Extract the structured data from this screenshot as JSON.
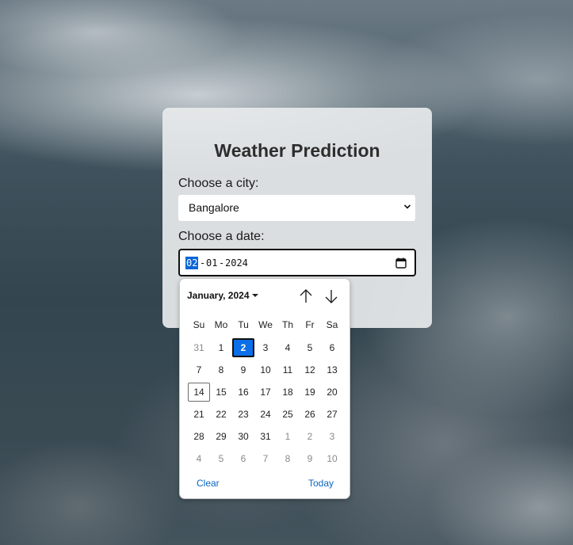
{
  "app": {
    "title": "Weather Prediction"
  },
  "form": {
    "city_label": "Choose a city:",
    "city_value": "Bangalore",
    "date_label": "Choose a date:",
    "date_parts": {
      "month": "02",
      "sep1": "-",
      "day": "01",
      "sep2": "-",
      "year": "2024"
    }
  },
  "calendar": {
    "month_label": "January, 2024",
    "weekdays": [
      "Su",
      "Mo",
      "Tu",
      "We",
      "Th",
      "Fr",
      "Sa"
    ],
    "weeks": [
      [
        {
          "d": "31",
          "other": true
        },
        {
          "d": "1"
        },
        {
          "d": "2",
          "selected": true
        },
        {
          "d": "3"
        },
        {
          "d": "4"
        },
        {
          "d": "5"
        },
        {
          "d": "6"
        }
      ],
      [
        {
          "d": "7"
        },
        {
          "d": "8"
        },
        {
          "d": "9"
        },
        {
          "d": "10"
        },
        {
          "d": "11"
        },
        {
          "d": "12"
        },
        {
          "d": "13"
        }
      ],
      [
        {
          "d": "14",
          "today": true
        },
        {
          "d": "15"
        },
        {
          "d": "16"
        },
        {
          "d": "17"
        },
        {
          "d": "18"
        },
        {
          "d": "19"
        },
        {
          "d": "20"
        }
      ],
      [
        {
          "d": "21"
        },
        {
          "d": "22"
        },
        {
          "d": "23"
        },
        {
          "d": "24"
        },
        {
          "d": "25"
        },
        {
          "d": "26"
        },
        {
          "d": "27"
        }
      ],
      [
        {
          "d": "28"
        },
        {
          "d": "29"
        },
        {
          "d": "30"
        },
        {
          "d": "31"
        },
        {
          "d": "1",
          "other": true
        },
        {
          "d": "2",
          "other": true
        },
        {
          "d": "3",
          "other": true
        }
      ],
      [
        {
          "d": "4",
          "other": true
        },
        {
          "d": "5",
          "other": true
        },
        {
          "d": "6",
          "other": true
        },
        {
          "d": "7",
          "other": true
        },
        {
          "d": "8",
          "other": true
        },
        {
          "d": "9",
          "other": true
        },
        {
          "d": "10",
          "other": true
        }
      ]
    ],
    "clear_label": "Clear",
    "today_label": "Today"
  },
  "colors": {
    "accent": "#0a6fe8",
    "link": "#0a66c2",
    "title": "#2e2e2e"
  },
  "icons": {
    "city_dropdown": "chevron-down-icon",
    "date_picker": "calendar-icon",
    "prev_month": "arrow-up-icon",
    "next_month": "arrow-down-icon",
    "month_menu": "caret-down-icon"
  }
}
